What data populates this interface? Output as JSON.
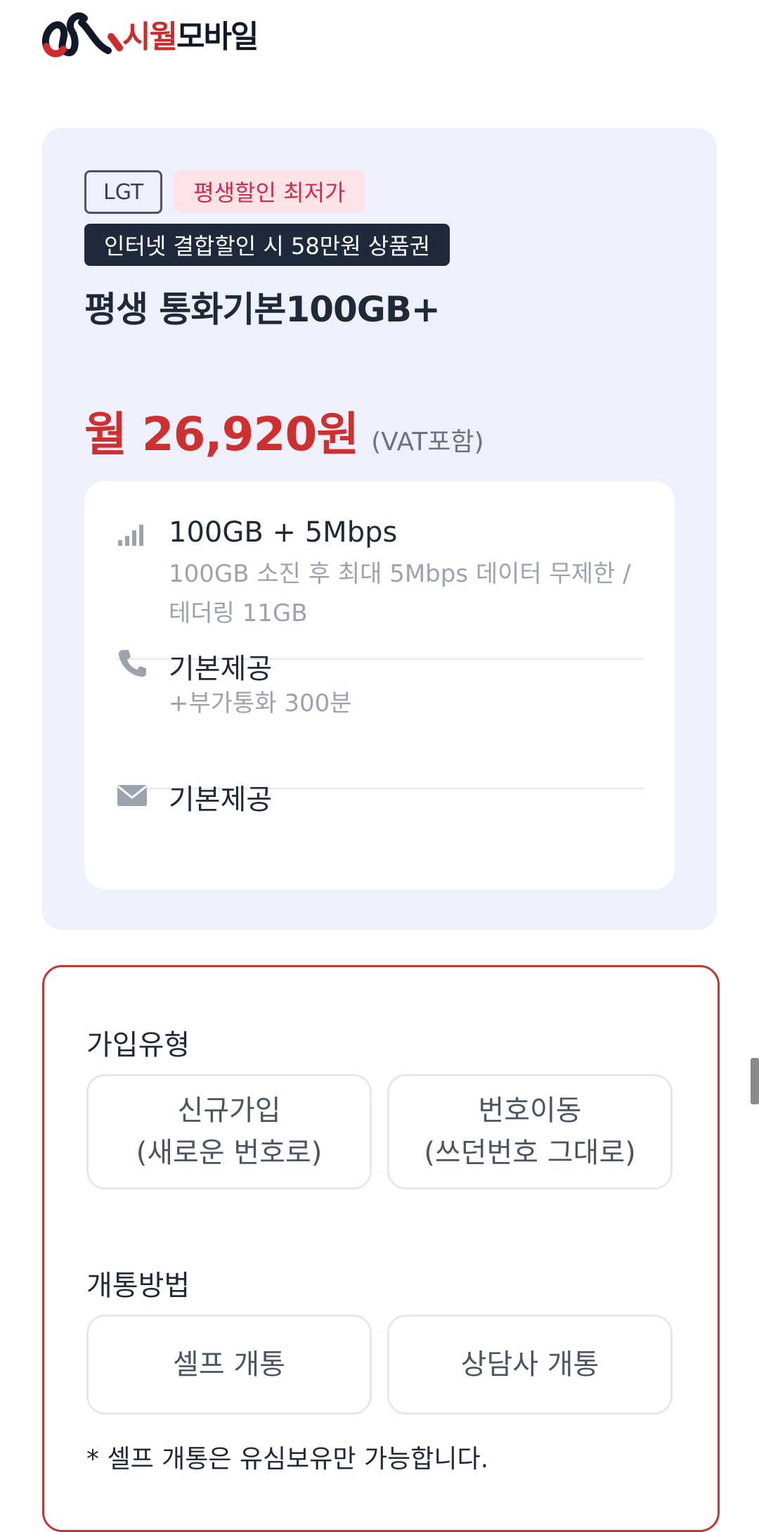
{
  "brand": {
    "name_part1": "시월",
    "name_part2": "모바일",
    "accent": "#d12a2a"
  },
  "plan": {
    "carrier_tag": "LGT",
    "promo_tag": "평생할인 최저가",
    "banner": "인터넷 결합할인 시 58만원 상품권",
    "title": "평생 통화기본100GB+",
    "price": "월 26,920원",
    "price_note": "(VAT포함)",
    "price_color": "#cf2f2f",
    "features": [
      {
        "icon": "signal-icon",
        "title": "100GB + 5Mbps",
        "desc": "100GB 소진 후 최대 5Mbps 데이터 무제한 / 테더링 11GB"
      },
      {
        "icon": "phone-icon",
        "title": "기본제공",
        "desc": "+부가통화 300분"
      },
      {
        "icon": "mail-icon",
        "title": "기본제공",
        "desc": ""
      }
    ]
  },
  "form": {
    "join_type_label": "가입유형",
    "join_options": [
      {
        "line1": "신규가입",
        "line2": "(새로운 번호로)"
      },
      {
        "line1": "번호이동",
        "line2": "(쓰던번호 그대로)"
      }
    ],
    "activation_label": "개통방법",
    "activation_options": [
      "셀프 개통",
      "상담사 개통"
    ],
    "note": "* 셀프 개통은 유심보유만 가능합니다.",
    "border_color": "#c0392b"
  }
}
